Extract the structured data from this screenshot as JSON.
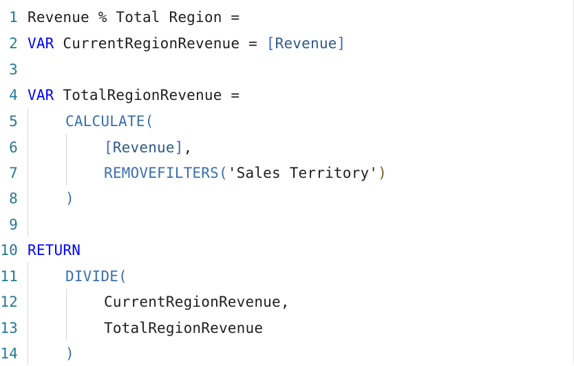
{
  "editor": {
    "lines": [
      {
        "num": "1",
        "text": "Revenue % Total Region ="
      },
      {
        "num": "2",
        "kw": "VAR",
        "name": " CurrentRegionRevenue = ",
        "bracket_open": "[",
        "measure": "Revenue",
        "bracket_close": "]"
      },
      {
        "num": "3"
      },
      {
        "num": "4",
        "kw": "VAR",
        "name": " TotalRegionRevenue ="
      },
      {
        "num": "5",
        "fn": "CALCULATE("
      },
      {
        "num": "6",
        "bracket_open": "[",
        "measure": "Revenue",
        "bracket_close": "]",
        "tail": ","
      },
      {
        "num": "7",
        "fn": "REMOVEFILTERS(",
        "str": "'Sales Territory'",
        "close": ")"
      },
      {
        "num": "8",
        "close": ")"
      },
      {
        "num": "9"
      },
      {
        "num": "10",
        "kw": "RETURN"
      },
      {
        "num": "11",
        "fn": "DIVIDE("
      },
      {
        "num": "12",
        "text": "CurrentRegionRevenue,"
      },
      {
        "num": "13",
        "text": "TotalRegionRevenue"
      },
      {
        "num": "14",
        "close": ")"
      }
    ]
  },
  "colors": {
    "keyword": "#0000ff",
    "function": "#3a6fb0",
    "line_number": "#237893",
    "text": "#1e1e1e"
  }
}
